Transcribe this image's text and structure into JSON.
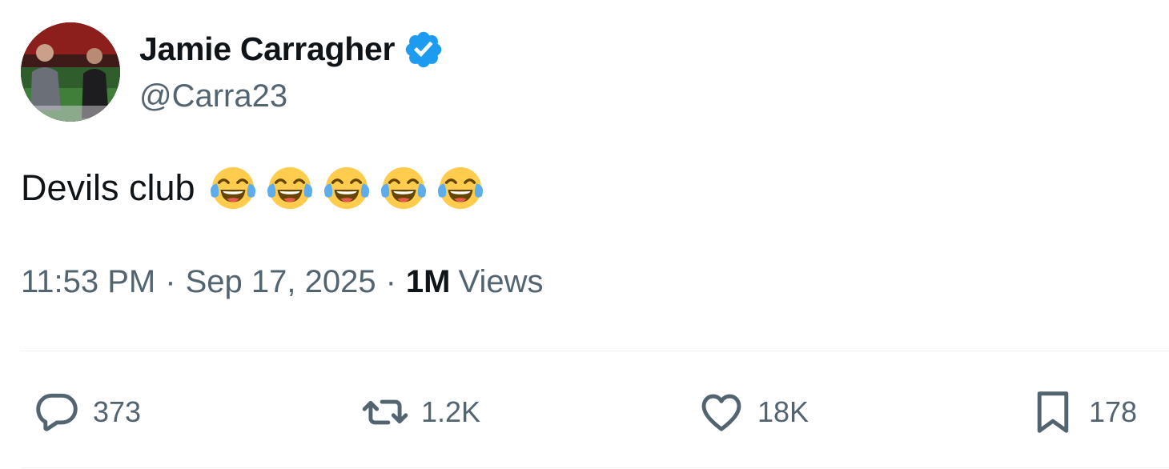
{
  "author": {
    "display_name": "Jamie Carragher",
    "handle": "@Carra23",
    "verified": true
  },
  "tweet": {
    "text": "Devils club",
    "emojis": [
      "face-with-tears-of-joy",
      "face-with-tears-of-joy",
      "face-with-tears-of-joy",
      "face-with-tears-of-joy",
      "face-with-tears-of-joy"
    ]
  },
  "meta": {
    "time": "11:53 PM",
    "separator": "·",
    "date": "Sep 17, 2025",
    "views_count": "1M",
    "views_label": "Views"
  },
  "actions": {
    "replies": "373",
    "retweets": "1.2K",
    "likes": "18K",
    "bookmarks": "178"
  },
  "colors": {
    "text_primary": "#0f1419",
    "text_secondary": "#536471",
    "verified_blue": "#1d9bf0",
    "divider": "#eff3f4"
  }
}
